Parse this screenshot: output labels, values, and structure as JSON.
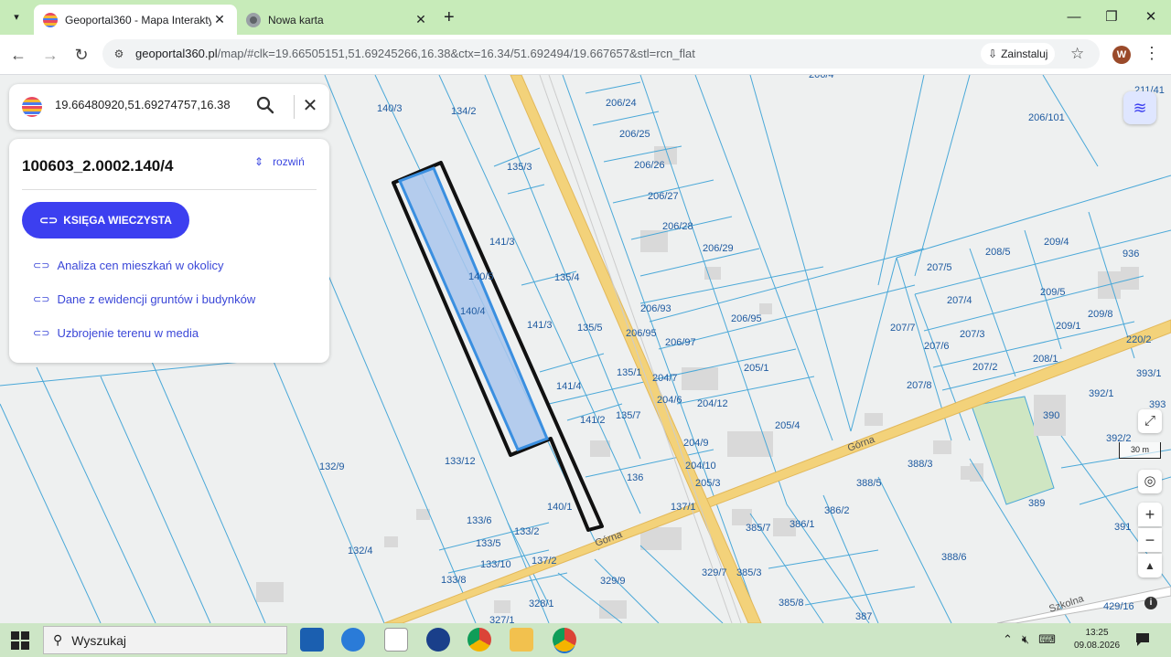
{
  "browser": {
    "tabs": [
      {
        "title": "Geoportal360 - Mapa Interakty",
        "active": true
      },
      {
        "title": "Nowa karta",
        "active": false
      }
    ],
    "url_host": "geoportal360.pl",
    "url_path": "/map/#clk=19.66505151,51.69245266,16.38&ctx=16.34/51.692494/19.667657&stl=rcn_flat",
    "install_label": "Zainstaluj",
    "profile_initial": "W"
  },
  "search": {
    "value": "19.66480920,51.69274757,16.38"
  },
  "panel": {
    "parcel_id": "100603_2.0002.140/4",
    "expand_label": "rozwiń",
    "kw_button": "KSIĘGA WIECZYSTA",
    "links": [
      "Analiza cen mieszkań w okolicy",
      "Dane z ewidencji gruntów i budynków",
      "Uzbrojenie terenu w media"
    ]
  },
  "map": {
    "scale_label": "30 m",
    "street_names": [
      "Górna",
      "Górna",
      "Szkolna"
    ],
    "parcel_labels": [
      "140/3",
      "134/2",
      "206/24",
      "206/25",
      "206/26",
      "206/27",
      "206/28",
      "206/29",
      "135/3",
      "141/3",
      "140/5",
      "140/4",
      "135/4",
      "141/3",
      "135/5",
      "206/93",
      "206/95",
      "206/95",
      "206/97",
      "206/101",
      "208/5",
      "209/4",
      "936",
      "207/5",
      "207/4",
      "209/5",
      "209/8",
      "209/1",
      "207/7",
      "207/6",
      "207/3",
      "220/2",
      "208/1",
      "207/2",
      "205/1",
      "207/8",
      "393/1",
      "392/1",
      "393",
      "141/4",
      "135/1",
      "204/7",
      "204/6",
      "204/12",
      "141/2",
      "135/7",
      "205/4",
      "390",
      "392/2",
      "204/9",
      "204/10",
      "205/3",
      "132/9",
      "133/12",
      "136",
      "388/3",
      "388/5",
      "389",
      "140/1",
      "137/1",
      "386/2",
      "386/1",
      "385/7",
      "391",
      "133/6",
      "133/2",
      "133/5",
      "132/4",
      "137/2",
      "133/10",
      "329/9",
      "388/6",
      "133/8",
      "329/7",
      "385/3",
      "328/1",
      "385/8",
      "387",
      "327/1",
      "429/16",
      "206/4",
      "211/41"
    ],
    "colors": {
      "parcel_line": "#4aa8d8",
      "road": "#f3d27a",
      "selected_fill": "#a9c6ec",
      "selected_stroke": "#3a8fe0",
      "green_area": "#cfe6c2"
    }
  },
  "taskbar": {
    "search_placeholder": "Wyszukaj",
    "time": "13:25",
    "date": "09.08.2026"
  }
}
